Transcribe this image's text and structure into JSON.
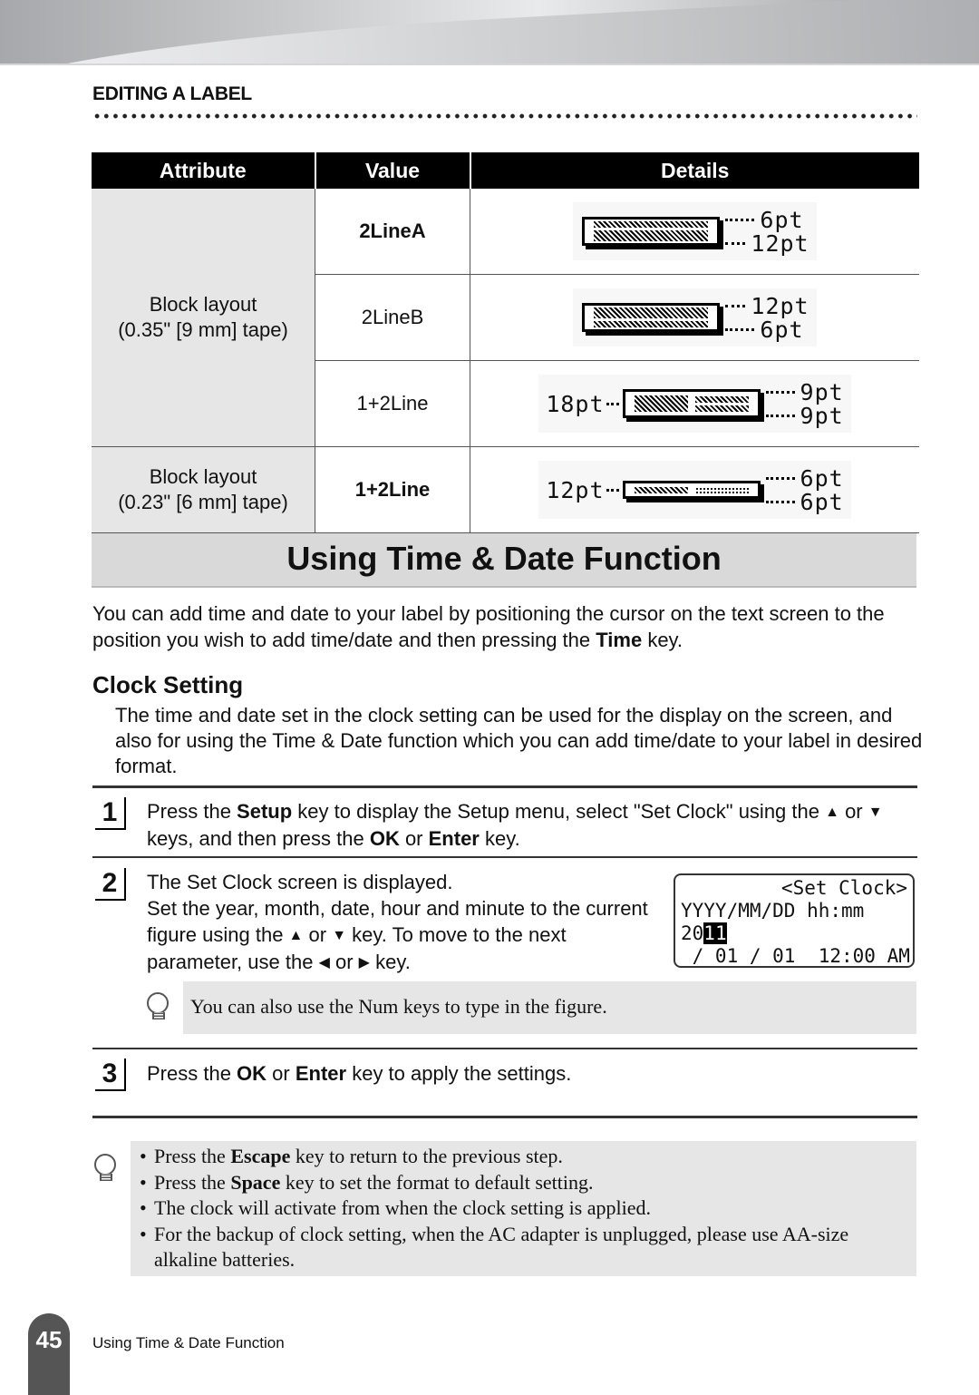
{
  "header": {
    "section": "EDITING A LABEL"
  },
  "table": {
    "columns": [
      "Attribute",
      "Value",
      "Details"
    ],
    "rows": [
      {
        "attribute": "Block layout\n(0.35\" [9 mm] tape)",
        "value": "2LineA",
        "value_bold": true,
        "diagram": {
          "left": "",
          "right": [
            "6pt",
            "12pt"
          ]
        }
      },
      {
        "value": "2LineB",
        "value_bold": false,
        "diagram": {
          "left": "",
          "right": [
            "12pt",
            "6pt"
          ]
        }
      },
      {
        "value": "1+2Line",
        "value_bold": false,
        "diagram": {
          "left": "18pt",
          "right": [
            "9pt",
            "9pt"
          ]
        }
      },
      {
        "attribute": "Block layout\n(0.23\" [6 mm] tape)",
        "value": "1+2Line",
        "value_bold": true,
        "diagram": {
          "left": "12pt",
          "right": [
            "6pt",
            "6pt"
          ]
        }
      }
    ],
    "attr_1_line1": "Block layout",
    "attr_1_line2": "(0.35\" [9 mm] tape)",
    "attr_2_line1": "Block layout",
    "attr_2_line2": "(0.23\" [6 mm] tape)"
  },
  "title": "Using Time & Date Function",
  "intro": {
    "before": "You can add time and date to your label by positioning the cursor on the text screen to the position you wish to add time/date and then pressing the ",
    "key": "Time",
    "after": " key."
  },
  "clock_setting": {
    "heading": "Clock Setting",
    "description": "The time and date set in the clock setting can be used for the display on the screen, and also for using the Time & Date function which you can add time/date to your label in desired format."
  },
  "steps": [
    {
      "number": "1",
      "parts": [
        "Press the ",
        "Setup",
        " key to display the Setup menu, select \"Set Clock\" using the ",
        "▲",
        " or ",
        "▼",
        " keys, and then press the ",
        "OK",
        " or ",
        "Enter",
        " key."
      ]
    },
    {
      "number": "2",
      "line1": "The Set Clock screen is displayed.",
      "line2": "Set the year, month, date, hour and minute to the current figure using the ",
      "up": "▲",
      "or": " or ",
      "down": "▼",
      "line3": " key. To move to the next parameter, use the ",
      "left": "◀",
      "right": "▶",
      "end": " key.",
      "tip": "You can also use the Num keys to type in the figure."
    },
    {
      "number": "3",
      "parts": [
        "Press the ",
        "OK",
        " or ",
        "Enter",
        " key to apply the settings."
      ]
    }
  ],
  "lcd": {
    "title": "<Set Clock>",
    "format": "YYYY/MM/DD hh:mm",
    "value_prefix": "20",
    "value_highlight": "11",
    "value_rest": " / 01 / 01  12:00 AM"
  },
  "notes": {
    "items": [
      {
        "before": "Press the ",
        "key": "Escape",
        "after": " key to return to the previous step."
      },
      {
        "before": "Press the ",
        "key": "Space",
        "after": " key to set the format to default setting."
      },
      {
        "before": "The clock will activate from when the clock setting is applied.",
        "key": "",
        "after": ""
      },
      {
        "before": "For the backup of clock setting, when the AC adapter is unplugged, please use AA-size alkaline batteries.",
        "key": "",
        "after": ""
      }
    ]
  },
  "footer": {
    "page_number": "45",
    "title": "Using Time & Date Function"
  }
}
